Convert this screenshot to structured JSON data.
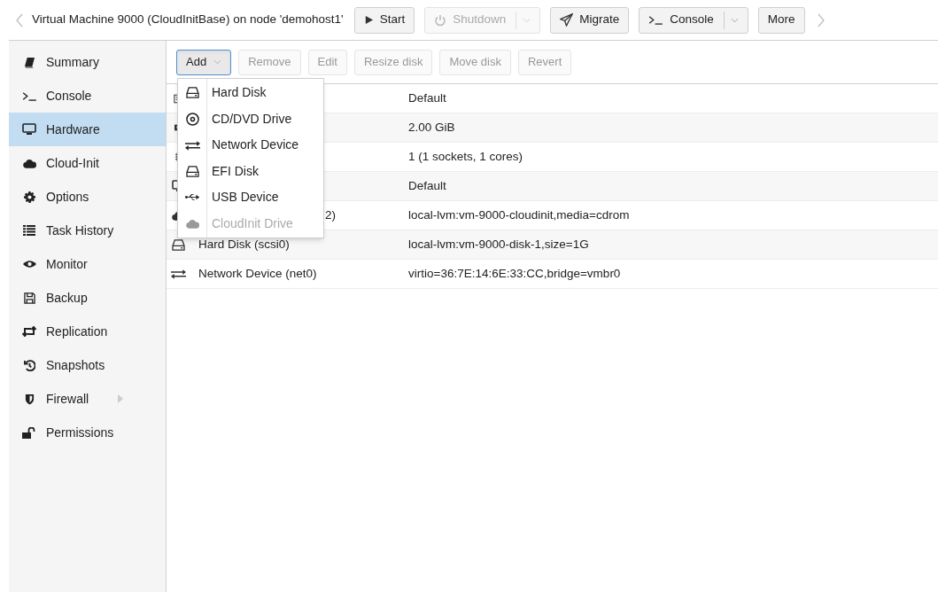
{
  "header": {
    "title": "Virtual Machine 9000 (CloudInitBase) on node 'demohost1'",
    "buttons": [
      {
        "label": "Start",
        "disabled": false,
        "split": false
      },
      {
        "label": "Shutdown",
        "disabled": true,
        "split": true
      },
      {
        "label": "Migrate",
        "disabled": false,
        "split": false
      },
      {
        "label": "Console",
        "disabled": false,
        "split": true
      },
      {
        "label": "More",
        "disabled": false,
        "split": false
      }
    ]
  },
  "sidebar": {
    "items": [
      {
        "label": "Summary",
        "selected": false,
        "has_submenu": false
      },
      {
        "label": "Console",
        "selected": false,
        "has_submenu": false
      },
      {
        "label": "Hardware",
        "selected": true,
        "has_submenu": false
      },
      {
        "label": "Cloud-Init",
        "selected": false,
        "has_submenu": false
      },
      {
        "label": "Options",
        "selected": false,
        "has_submenu": false
      },
      {
        "label": "Task History",
        "selected": false,
        "has_submenu": false
      },
      {
        "label": "Monitor",
        "selected": false,
        "has_submenu": false
      },
      {
        "label": "Backup",
        "selected": false,
        "has_submenu": false
      },
      {
        "label": "Replication",
        "selected": false,
        "has_submenu": false
      },
      {
        "label": "Snapshots",
        "selected": false,
        "has_submenu": false
      },
      {
        "label": "Firewall",
        "selected": false,
        "has_submenu": true
      },
      {
        "label": "Permissions",
        "selected": false,
        "has_submenu": false
      }
    ]
  },
  "toolbar": [
    {
      "label": "Add",
      "disabled": false,
      "split": true,
      "pressed": true
    },
    {
      "label": "Remove",
      "disabled": true,
      "split": false,
      "pressed": false
    },
    {
      "label": "Edit",
      "disabled": true,
      "split": false,
      "pressed": false
    },
    {
      "label": "Resize disk",
      "disabled": true,
      "split": false,
      "pressed": false
    },
    {
      "label": "Move disk",
      "disabled": true,
      "split": false,
      "pressed": false
    },
    {
      "label": "Revert",
      "disabled": true,
      "split": false,
      "pressed": false
    }
  ],
  "table": {
    "rows": [
      {
        "value": "Default"
      },
      {
        "value": "2.00 GiB"
      },
      {
        "value": "1 (1 sockets, 1 cores)"
      },
      {
        "value": "Default"
      },
      {
        "key": "2)",
        "value": "local-lvm:vm-9000-cloudinit,media=cdrom"
      },
      {
        "key": "Hard Disk (scsi0)",
        "value": "local-lvm:vm-9000-disk-1,size=1G"
      },
      {
        "key": "Network Device (net0)",
        "value": "virtio=36:7E:14:6E:33:CC,bridge=vmbr0"
      }
    ]
  },
  "add_menu": {
    "items": [
      {
        "label": "Hard Disk",
        "disabled": false
      },
      {
        "label": "CD/DVD Drive",
        "disabled": false
      },
      {
        "label": "Network Device",
        "disabled": false
      },
      {
        "label": "EFI Disk",
        "disabled": false
      },
      {
        "label": "USB Device",
        "disabled": false
      },
      {
        "label": "CloudInit Drive",
        "disabled": true
      }
    ]
  }
}
